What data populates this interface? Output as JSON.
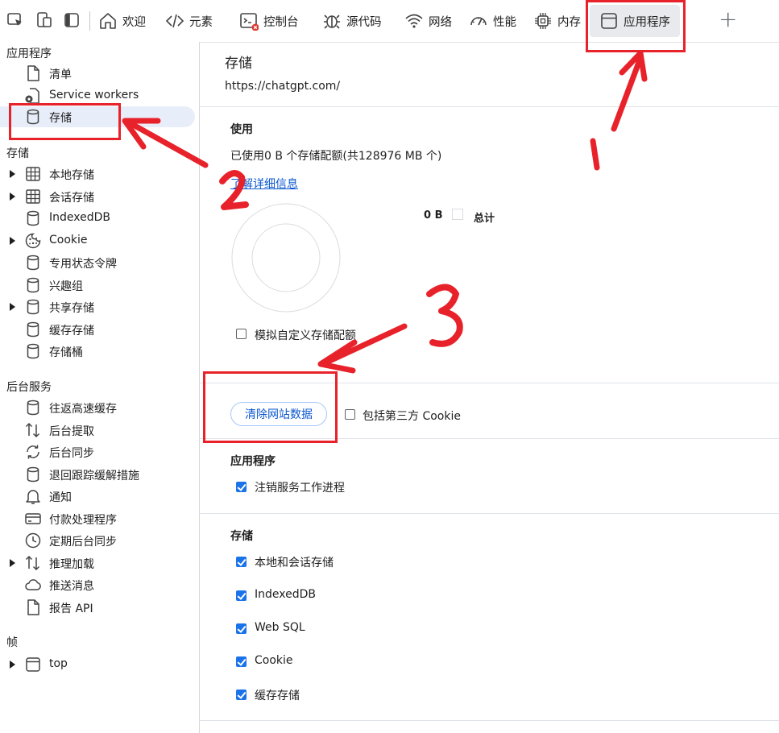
{
  "toolbar": {
    "tabs": [
      {
        "label": "欢迎",
        "icon": "home-icon"
      },
      {
        "label": "元素",
        "icon": "code-icon"
      },
      {
        "label": "控制台",
        "icon": "console-icon"
      },
      {
        "label": "源代码",
        "icon": "bug-icon"
      },
      {
        "label": "网络",
        "icon": "wifi-icon"
      },
      {
        "label": "性能",
        "icon": "gauge-icon"
      },
      {
        "label": "内存",
        "icon": "chip-icon"
      },
      {
        "label": "应用程序",
        "icon": "window-icon",
        "active": true
      }
    ],
    "add_label": "+"
  },
  "sidebar": {
    "app_section": "应用程序",
    "app_items": [
      {
        "label": "清单",
        "icon": "file-icon"
      },
      {
        "label": "Service workers",
        "icon": "gear-file-icon"
      },
      {
        "label": "存储",
        "icon": "database-icon",
        "selected": true
      }
    ],
    "storage_section": "存储",
    "storage_items": [
      {
        "label": "本地存储",
        "icon": "grid-icon",
        "expandable": true
      },
      {
        "label": "会话存储",
        "icon": "grid-icon",
        "expandable": true
      },
      {
        "label": "IndexedDB",
        "icon": "database-icon"
      },
      {
        "label": "Cookie",
        "icon": "cookie-icon",
        "expandable": true
      },
      {
        "label": "专用状态令牌",
        "icon": "database-icon"
      },
      {
        "label": "兴趣组",
        "icon": "database-icon"
      },
      {
        "label": "共享存储",
        "icon": "database-icon",
        "expandable": true
      },
      {
        "label": "缓存存储",
        "icon": "database-icon"
      },
      {
        "label": "存储桶",
        "icon": "database-icon"
      }
    ],
    "bg_section": "后台服务",
    "bg_items": [
      {
        "label": "往返高速缓存",
        "icon": "database-icon"
      },
      {
        "label": "后台提取",
        "icon": "updown-arrows-icon"
      },
      {
        "label": "后台同步",
        "icon": "sync-icon"
      },
      {
        "label": "退回跟踪缓解措施",
        "icon": "database-icon"
      },
      {
        "label": "通知",
        "icon": "bell-icon"
      },
      {
        "label": "付款处理程序",
        "icon": "card-icon"
      },
      {
        "label": "定期后台同步",
        "icon": "clock-icon"
      },
      {
        "label": "推理加载",
        "icon": "updown-arrows-icon",
        "expandable": true
      },
      {
        "label": "推送消息",
        "icon": "cloud-icon"
      },
      {
        "label": "报告 API",
        "icon": "file-icon"
      }
    ],
    "frames_section": "帧",
    "frames_items": [
      {
        "label": "top",
        "icon": "frame-icon",
        "expandable": true
      }
    ]
  },
  "main": {
    "title": "存储",
    "origin": "https://chatgpt.com/",
    "usage_heading": "使用",
    "usage_text": "已使用0 B 个存储配额(共128976 MB 个)",
    "learn_more": "了解详细信息",
    "legend_value": "0 B",
    "legend_label": "总计",
    "simulate_quota": "模拟自定义存储配额",
    "clear_button": "清除网站数据",
    "third_party_cookie": "包括第三方 Cookie",
    "app_heading": "应用程序",
    "app_options": [
      {
        "label": "注销服务工作进程",
        "checked": true
      }
    ],
    "storage_heading": "存储",
    "storage_options": [
      {
        "label": "本地和会话存储",
        "checked": true
      },
      {
        "label": "IndexedDB",
        "checked": true
      },
      {
        "label": "Web SQL",
        "checked": true
      },
      {
        "label": "Cookie",
        "checked": true
      },
      {
        "label": "缓存存储",
        "checked": true
      }
    ]
  },
  "annotations": {
    "step1": "1",
    "step2": "2",
    "step3": "3",
    "color": "#e8222a"
  }
}
